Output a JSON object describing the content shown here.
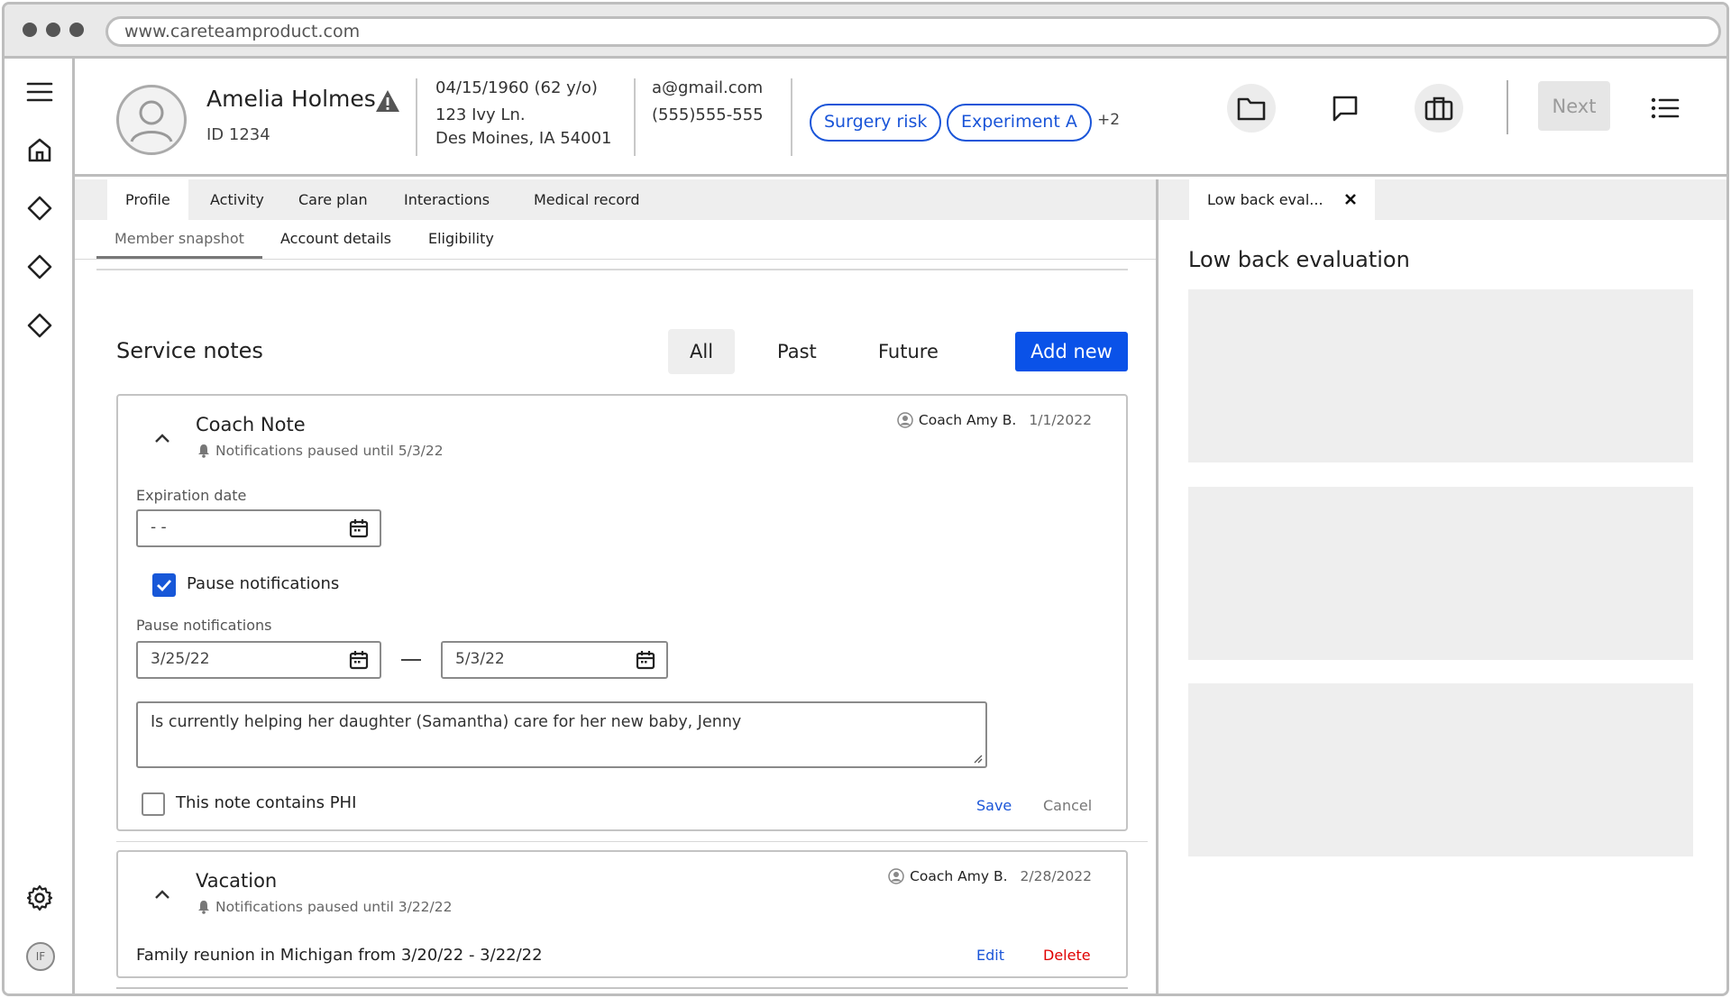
{
  "browser": {
    "url": "www.careteamproduct.com"
  },
  "rail": {
    "user_initials": "IF"
  },
  "member": {
    "name": "Amelia Holmes",
    "id": "ID 1234",
    "dob": "04/15/1960  (62 y/o)",
    "address_line1": "123 Ivy Ln.",
    "address_line2": "Des Moines, IA  54001",
    "email": "a@gmail.com",
    "phone": "(555)555-555"
  },
  "tags": {
    "items": [
      "Surgery risk",
      "Experiment A"
    ],
    "more": "+2"
  },
  "header_actions": {
    "next_label": "Next"
  },
  "tabs": [
    "Profile",
    "Activity",
    "Care plan",
    "Interactions",
    "Medical record"
  ],
  "subtabs": [
    "Member snapshot",
    "Account details",
    "Eligibility"
  ],
  "right_pane": {
    "tab_label": "Low back eval...",
    "title": "Low back evaluation"
  },
  "service_notes": {
    "title": "Service notes",
    "filters": [
      "All",
      "Past",
      "Future"
    ],
    "add_label": "Add new",
    "note1": {
      "title": "Coach Note",
      "notice": "Notifications paused until 5/3/22",
      "author": "Coach Amy B.",
      "date": "1/1/2022",
      "expiration_label": "Expiration date",
      "expiration_value": "- -",
      "pause_checkbox_label": "Pause notifications",
      "pause_checked": true,
      "pause_range_label": "Pause notifications",
      "pause_start": "3/25/22",
      "pause_end": "5/3/22",
      "text": "Is currently helping her daughter (Samantha) care for her new baby, Jenny",
      "phi_label": "This note contains PHI",
      "phi_checked": false,
      "save_label": "Save",
      "cancel_label": "Cancel"
    },
    "note2": {
      "title": "Vacation",
      "notice": "Notifications paused until 3/22/22",
      "author": "Coach Amy B.",
      "date": "2/28/2022",
      "text": "Family reunion in Michigan from 3/20/22 - 3/22/22",
      "edit_label": "Edit",
      "delete_label": "Delete"
    }
  },
  "colors": {
    "accent": "#0a52e8",
    "tag_border": "#1a55d8",
    "danger": "#e00000"
  }
}
